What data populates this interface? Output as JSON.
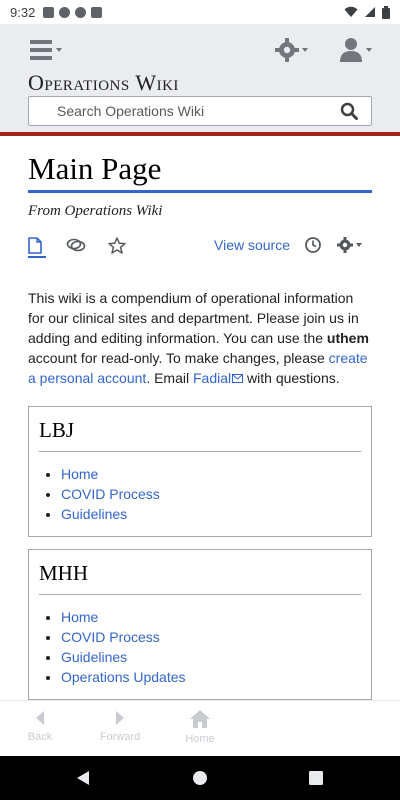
{
  "status_bar": {
    "time": "9:32",
    "left_icons": [
      "notification-a-icon",
      "notification-b-icon",
      "notification-c-icon",
      "sd-card-icon"
    ],
    "right_icons": [
      "wifi-icon",
      "signal-icon",
      "battery-icon"
    ]
  },
  "header": {
    "wiki_name": "Operations Wiki",
    "search": {
      "placeholder": "Search Operations Wiki",
      "value": ""
    }
  },
  "page": {
    "title": "Main Page",
    "subtitle": "From Operations Wiki",
    "actions": {
      "view_source": "View source"
    },
    "intro": {
      "text_1": "This wiki is a compendium of operational information for our clinical sites and department. Please join us in adding and editing information. You can use the ",
      "bold_user": "uthem",
      "text_2": " account for read-only. To make changes, please ",
      "create_link": "create a personal account",
      "text_3": ". Email ",
      "email_link": "Fadial",
      "text_4": " with questions."
    },
    "boxes": [
      {
        "title": "LBJ",
        "links": [
          "Home",
          "COVID Process",
          "Guidelines"
        ]
      },
      {
        "title": "MHH",
        "links": [
          "Home",
          "COVID Process",
          "Guidelines",
          "Operations Updates"
        ]
      }
    ]
  },
  "toolbar": {
    "back_label": "Back",
    "forward_label": "Forward",
    "home_label": "Home"
  },
  "colors": {
    "link": "#3366cc",
    "header_bg": "#eaecf0",
    "accent_rule": "#a2241f",
    "disabled": "#c8ccd1"
  }
}
